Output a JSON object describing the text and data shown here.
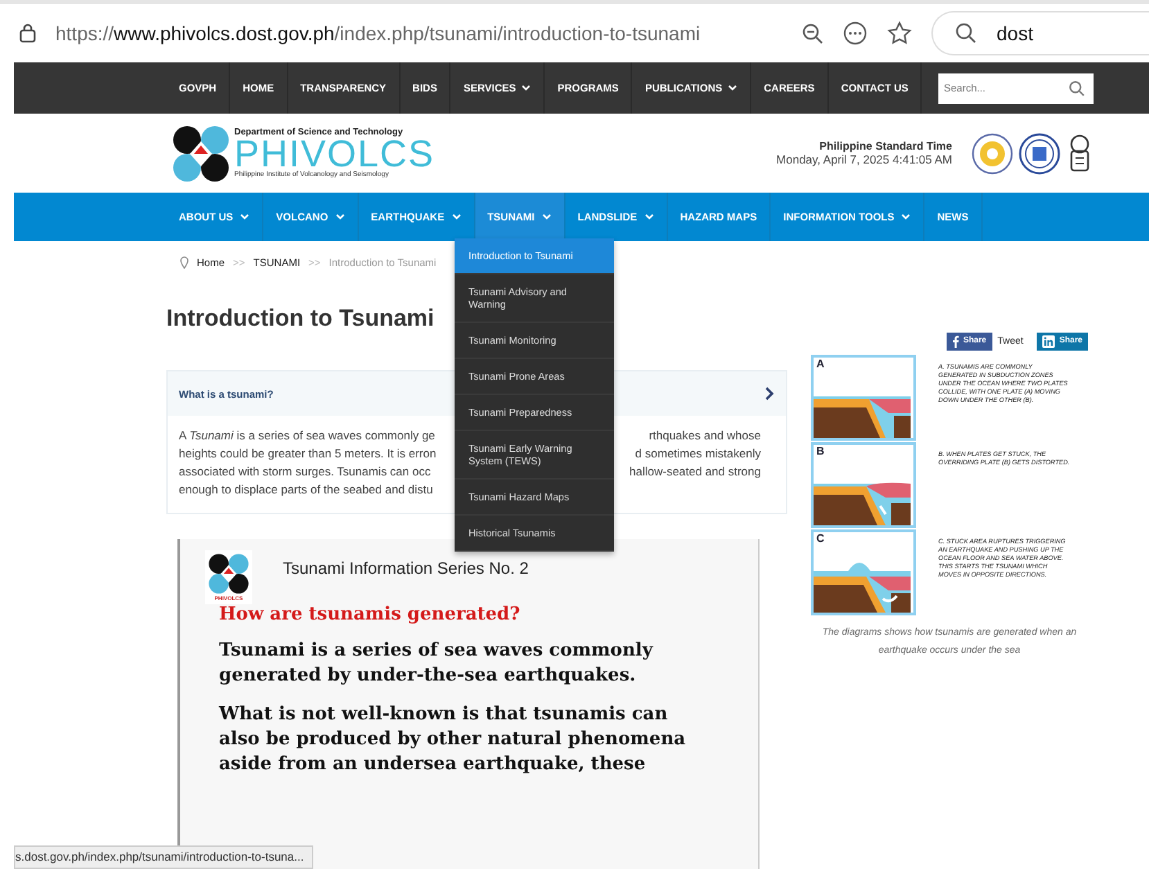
{
  "browser": {
    "url": "https://**www.phivolcs.dost.gov.ph**/index.php/tsunami/introduction-to-tsunami",
    "search": "dost"
  },
  "top_nav": {
    "items": [
      {
        "label": "GOVPH",
        "dropdown": false
      },
      {
        "label": "HOME",
        "dropdown": false
      },
      {
        "label": "TRANSPARENCY",
        "dropdown": false
      },
      {
        "label": "BIDS",
        "dropdown": false
      },
      {
        "label": "SERVICES",
        "dropdown": true
      },
      {
        "label": "PROGRAMS",
        "dropdown": false
      },
      {
        "label": "PUBLICATIONS",
        "dropdown": true
      },
      {
        "label": "CAREERS",
        "dropdown": false
      },
      {
        "label": "CONTACT US",
        "dropdown": false
      }
    ],
    "search_placeholder": "Search..."
  },
  "header": {
    "department": "Department of Science and Technology",
    "brand": "PHIVOLCS",
    "institute": "Philippine Institute of Volcanology and Seismology",
    "time_label": "Philippine Standard Time",
    "time": "Monday, April 7, 2025 4:41:05 AM"
  },
  "main_nav": [
    {
      "label": "ABOUT US",
      "dropdown": true,
      "selected": false
    },
    {
      "label": "VOLCANO",
      "dropdown": true,
      "selected": false
    },
    {
      "label": "EARTHQUAKE",
      "dropdown": true,
      "selected": false
    },
    {
      "label": "TSUNAMI",
      "dropdown": true,
      "selected": true
    },
    {
      "label": "LANDSLIDE",
      "dropdown": true,
      "selected": false
    },
    {
      "label": "HAZARD MAPS",
      "dropdown": false,
      "selected": false
    },
    {
      "label": "INFORMATION TOOLS",
      "dropdown": true,
      "selected": false
    },
    {
      "label": "NEWS",
      "dropdown": false,
      "selected": false
    }
  ],
  "dropdown": [
    {
      "label": "Introduction to Tsunami",
      "selected": true
    },
    {
      "label": "Tsunami Advisory and Warning",
      "selected": false
    },
    {
      "label": "Tsunami Monitoring",
      "selected": false
    },
    {
      "label": "Tsunami Prone Areas",
      "selected": false
    },
    {
      "label": "Tsunami Preparedness",
      "selected": false
    },
    {
      "label": "Tsunami Early Warning System (TEWS)",
      "selected": false
    },
    {
      "label": "Tsunami Hazard Maps",
      "selected": false
    },
    {
      "label": "Historical Tsunamis",
      "selected": false
    }
  ],
  "breadcrumb": [
    "Home",
    ">>",
    "TSUNAMI",
    ">>",
    "Introduction to Tsunami"
  ],
  "title": "Introduction to Tsunami",
  "accordion": {
    "question": "What is a tsunami?",
    "expanded": true,
    "lines": [
      {
        "left": "A *Tsunami* is a series of sea waves commonly ge",
        "right": "rthquakes and whose"
      },
      {
        "left": "heights could be greater than 5 meters. It is erron",
        "right": "d sometimes mistakenly"
      },
      {
        "left": "associated with storm surges. Tsunamis can occ",
        "right": "hallow-seated and strong"
      },
      {
        "left": "enough to displace parts of the seabed and distu"
      }
    ]
  },
  "info_card": {
    "logo_text": "PHIVOLCS",
    "series": "Tsunami Information Series No. 2",
    "heading": "How are tsunamis generated?",
    "paragraphs": [
      "Tsunami is a series of sea waves commonly generated by under-the-sea earthquakes.",
      "What is not well-known is that tsunamis can also be produced by other natural phenomena aside from an undersea earthquake, these"
    ]
  },
  "share": {
    "facebook": "Share",
    "tweet": "Tweet",
    "linkedin": "Share"
  },
  "diagrams": [
    {
      "label": "A",
      "caption": "A. TSUNAMIS ARE COMMONLY GENERATED IN SUBDUCTION ZONES UNDER THE OCEAN WHERE TWO PLATES COLLIDE, WITH ONE PLATE (A) MOVING DOWN UNDER THE OTHER (B).",
      "kind": "subduction"
    },
    {
      "label": "B",
      "caption": "B. WHEN PLATES GET STUCK, THE OVERRIDING PLATE (B) GETS DISTORTED.",
      "kind": "stuck"
    },
    {
      "label": "C",
      "caption": "C. STUCK AREA RUPTURES TRIGGERING AN EARTHQUAKE AND PUSHING UP THE OCEAN FLOOR AND SEA WATER ABOVE. THIS STARTS THE TSUNAMI WHICH MOVES IN OPPOSITE DIRECTIONS.",
      "kind": "rupture"
    }
  ],
  "diagram_note": "The diagrams shows how tsunamis are generated when an earthquake occurs under the sea",
  "status_bar": "s.dost.gov.ph/index.php/tsunami/introduction-to-tsuna..."
}
